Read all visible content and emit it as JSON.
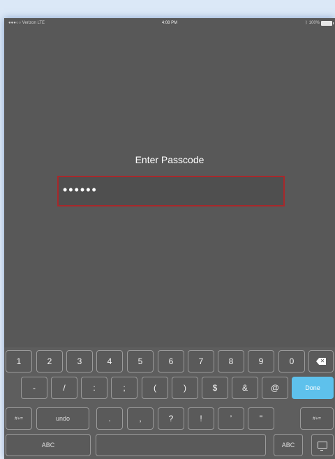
{
  "status_bar": {
    "carrier": "●●●○○ Verizon  LTE",
    "time": "4:08 PM",
    "battery": "100%",
    "bluetooth_icon": "bluetooth-icon"
  },
  "passcode": {
    "prompt": "Enter Passcode",
    "masked_value": "••••••"
  },
  "keyboard": {
    "row1": [
      "1",
      "2",
      "3",
      "4",
      "5",
      "6",
      "7",
      "8",
      "9",
      "0"
    ],
    "delete_icon": "backspace-icon",
    "row2": [
      "-",
      "/",
      ":",
      ";",
      "(",
      ")",
      "$",
      "&",
      "@"
    ],
    "done_label": "Done",
    "shift_symbols_label": "#+=",
    "undo_label": "undo",
    "row3": [
      ".",
      ",",
      "?",
      "!",
      "’",
      "\""
    ],
    "shift_symbols_right_label": "#+=",
    "abc_left_label": "ABC",
    "abc_right_label": "ABC",
    "dismiss_icon": "keyboard-dismiss-icon"
  }
}
